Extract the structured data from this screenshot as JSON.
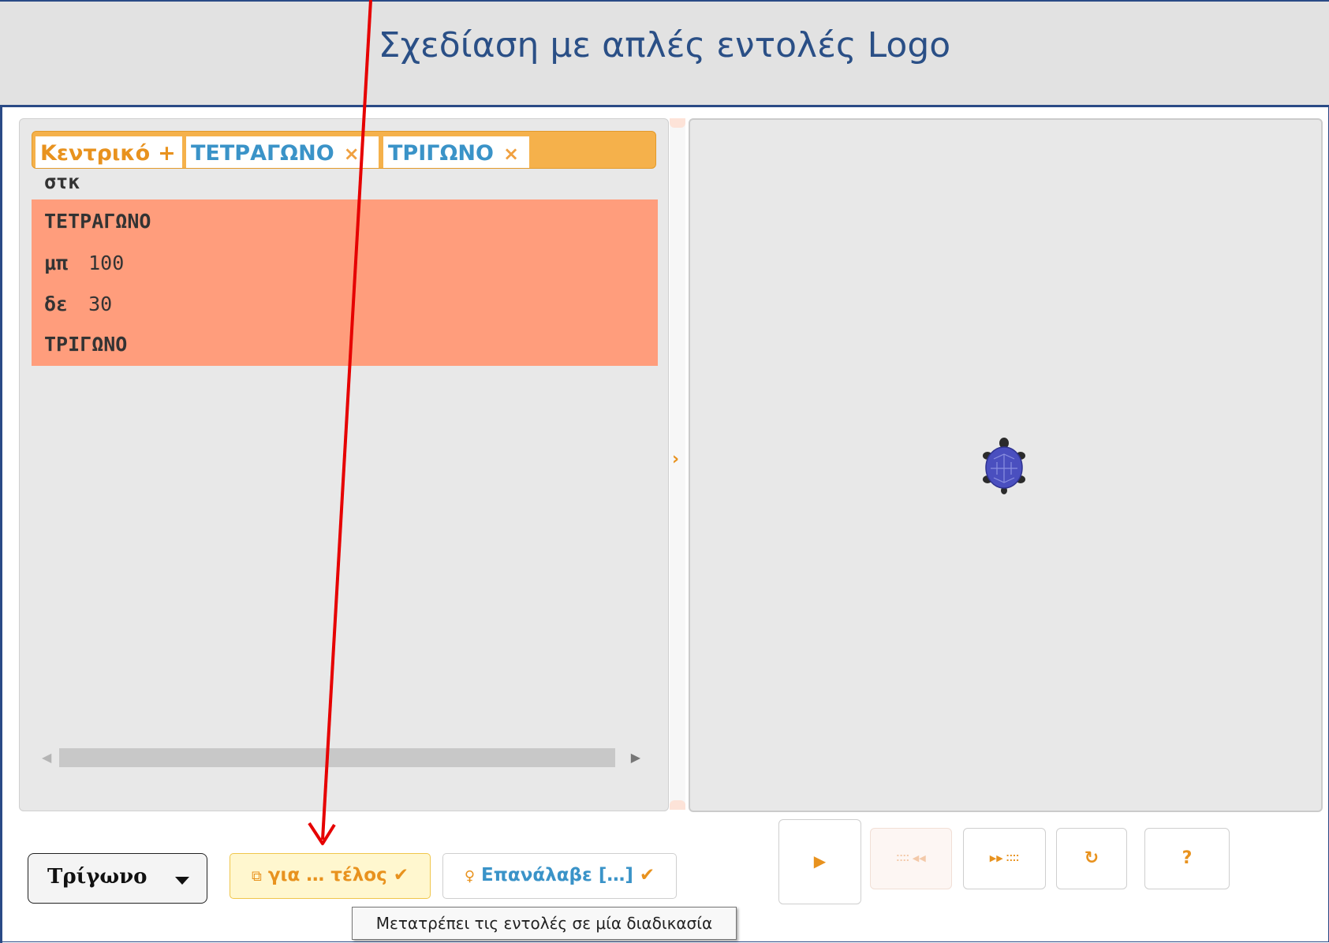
{
  "header": {
    "title": "Σχεδίαση με απλές εντολές Logo"
  },
  "editor": {
    "tabs": [
      {
        "label": "Κεντρικό",
        "symbol": "+"
      },
      {
        "label": "ΤΕΤΡΑΓΩΝΟ",
        "symbol": "×"
      },
      {
        "label": "ΤΡΙΓΩΝΟ",
        "symbol": "×"
      }
    ],
    "lines": [
      {
        "cmd": "στκ",
        "arg": "",
        "highlighted": false
      },
      {
        "cmd": "ΤΕΤΡΑΓΩΝΟ",
        "arg": "",
        "highlighted": true
      },
      {
        "cmd": "μπ",
        "arg": "100",
        "highlighted": true
      },
      {
        "cmd": "δε",
        "arg": "30",
        "highlighted": true
      },
      {
        "cmd": "ΤΡΙΓΩΝΟ",
        "arg": "",
        "highlighted": true
      }
    ]
  },
  "toolbar": {
    "select_value": "Τρίγωνο",
    "procedure_button": "για … τέλος",
    "repeat_button": "Επανάλαβε […]",
    "tooltip": "Μετατρέπει τις εντολές σε μία διαδικασία"
  },
  "controls": {
    "run": "▶",
    "step_back": "⁚⁚⁚⁚ ◀◀",
    "step_forward": "▶▶ ⁚⁚⁚⁚",
    "reset": "↻",
    "help": "?"
  },
  "icons": {
    "turtle": "turtle-icon",
    "procedure": "window-restore-icon",
    "repeat": "lightbulb-icon"
  },
  "colors": {
    "accent_orange": "#e8921e",
    "accent_blue": "#3a93c8",
    "highlight": "#ff9d7c",
    "header_blue": "#2a4f86",
    "annotation_red": "#e60000"
  }
}
